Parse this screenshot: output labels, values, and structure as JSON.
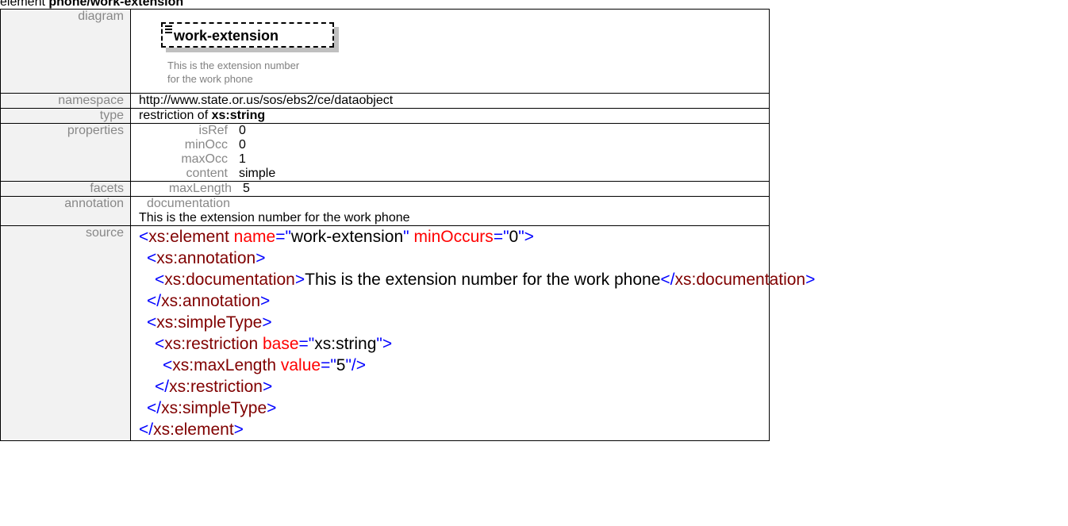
{
  "title": {
    "prefix": "element",
    "name": "phone/work-extension"
  },
  "diagram": {
    "label": "diagram",
    "element_name": "work-extension",
    "doc_line_1": "This is the extension number",
    "doc_line_2": "for the work phone",
    "icon": "documentation-icon"
  },
  "namespace": {
    "label": "namespace",
    "value": "http://www.state.or.us/sos/ebs2/ce/dataobject"
  },
  "type": {
    "label": "type",
    "prefix": "restriction of",
    "base": "xs:string"
  },
  "properties": {
    "label": "properties",
    "rows": [
      {
        "key": "isRef",
        "value": "0"
      },
      {
        "key": "minOcc",
        "value": "0"
      },
      {
        "key": "maxOcc",
        "value": "1"
      },
      {
        "key": "content",
        "value": "simple"
      }
    ]
  },
  "facets": {
    "label": "facets",
    "key": "maxLength",
    "value": "5"
  },
  "annotation": {
    "label": "annotation",
    "sub_label": "documentation",
    "text": "This is the extension number for the work phone"
  },
  "source": {
    "label": "source",
    "element_open": "xs:element",
    "attr_name": "name",
    "attr_name_value": "work-extension",
    "attr_minoccurs": "minOccurs",
    "attr_minoccurs_value": "0",
    "annotation_tag": "xs:annotation",
    "documentation_tag": "xs:documentation",
    "documentation_text": "This is the extension number for the work phone",
    "simpletype_tag": "xs:simpleType",
    "restriction_tag": "xs:restriction",
    "base_attr": "base",
    "base_value": "xs:string",
    "maxlength_tag": "xs:maxLength",
    "value_attr": "value",
    "value_value": "5"
  },
  "colors": {
    "tag": "#0000ff",
    "element_name": "#800000",
    "attribute_name": "#ff0000",
    "label_text": "#888888",
    "label_bg": "#f2f2f2"
  }
}
